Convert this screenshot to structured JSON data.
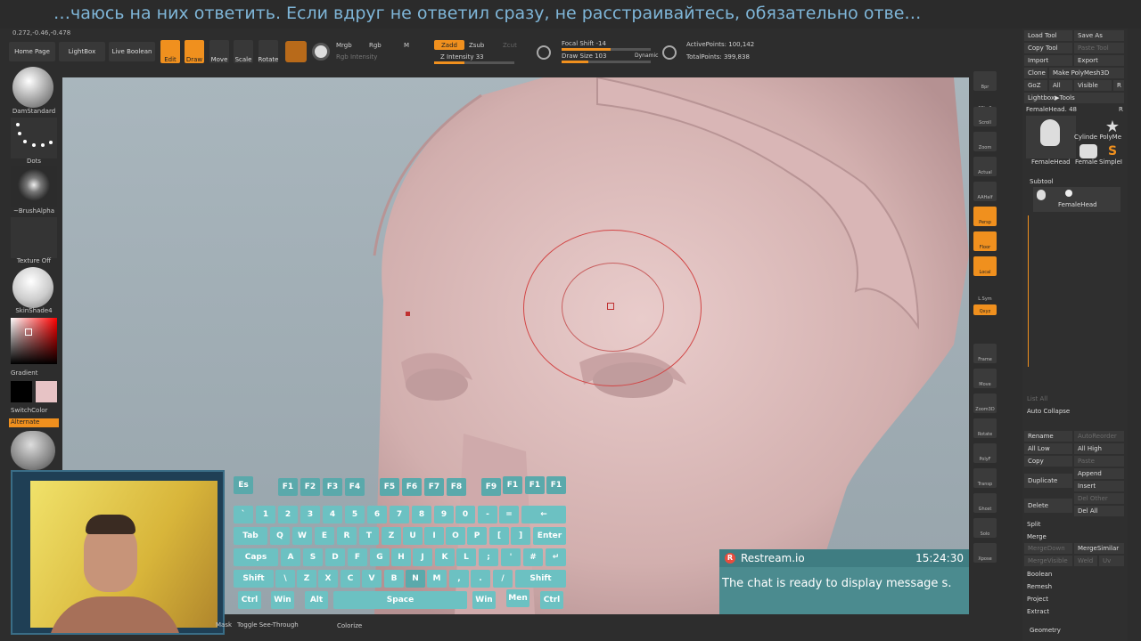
{
  "caption": {
    "text": "…чаюсь на них ответить. Если вдруг не ответил сразу, не расстраивайтесь, обязательно отве…"
  },
  "coords": "0.272,-0.46,-0.478",
  "topbar": {
    "home_page": "Home Page",
    "lightbox": "LightBox",
    "live_boolean": "Live Boolean",
    "edit": "Edit",
    "draw": "Draw",
    "move": "Move",
    "scale": "Scale",
    "rotate": "Rotate",
    "mrgb": "Mrgb",
    "rgb": "Rgb",
    "m": "M",
    "rgb_intensity": "Rgb Intensity",
    "zadd": "Zadd",
    "zsub": "Zsub",
    "zcut": "Zcut",
    "z_intensity": "Z Intensity 33",
    "focal_shift": "Focal Shift -14",
    "draw_size": "Draw Size 103",
    "dynamic": "Dynamic",
    "active_points": "ActivePoints: 100,142",
    "total_points": "TotalPoints: 399,838"
  },
  "left_panel": {
    "brush": "DamStandard",
    "stroke": "Dots",
    "alpha": "~BrushAlpha",
    "texture": "Texture Off",
    "material": "SkinShade4",
    "gradient": "Gradient",
    "switch_color": "SwitchColor",
    "alternate": "Alternate"
  },
  "right_strip": [
    "Bpr",
    "SPix 3",
    "Scroll",
    "Zoom",
    "Actual",
    "AAHalf",
    "Persp",
    "Floor",
    "Local",
    "L.Sym",
    "Qxyz",
    "",
    "Frame",
    "Move",
    "Zoom3D",
    "Rotate",
    "PolyF",
    "Transp",
    "Ghost",
    "Solo",
    "Xpose"
  ],
  "right_panel": {
    "load_tool": "Load Tool",
    "save_as": "Save As",
    "copy_tool": "Copy Tool",
    "paste_tool": "Paste Tool",
    "import": "Import",
    "export": "Export",
    "clone": "Clone",
    "make_polymesh": "Make PolyMesh3D",
    "goz": "GoZ",
    "all": "All",
    "visible": "Visible",
    "r": "R",
    "lightbox_tools": "Lightbox▶Tools",
    "female_head_48": "FemaleHead. 48",
    "tool_thumbs": [
      "FemaleHead",
      "Cylinde PolyMe",
      "Female",
      "SimpleI"
    ],
    "subtool": "Subtool",
    "subtool_item": "FemaleHead",
    "list_all": "List All",
    "auto_collapse": "Auto Collapse",
    "rename": "Rename",
    "auto_reorder": "AutoReorder",
    "all_low": "All Low",
    "all_high": "All High",
    "copy": "Copy",
    "paste": "Paste",
    "duplicate": "Duplicate",
    "append": "Append",
    "insert": "Insert",
    "delete": "Delete",
    "del_other": "Del Other",
    "del_all": "Del All",
    "split": "Split",
    "merge": "Merge",
    "merge_down": "MergeDown",
    "merge_similar": "MergeSimilar",
    "merge_visible": "MergeVisible",
    "weld": "Weld",
    "uv": "Uv",
    "boolean": "Boolean",
    "remesh": "Remesh",
    "project": "Project",
    "extract": "Extract",
    "geometry": "Geometry"
  },
  "keyboard": {
    "row0": [
      "Es",
      "F1",
      "F2",
      "F3",
      "F4",
      "F5",
      "F6",
      "F7",
      "F8",
      "F9",
      "F1",
      "F1",
      "F1"
    ],
    "row1": [
      "`",
      "1",
      "2",
      "3",
      "4",
      "5",
      "6",
      "7",
      "8",
      "9",
      "0",
      "-",
      "=",
      "←"
    ],
    "row2": [
      "Tab",
      "Q",
      "W",
      "E",
      "R",
      "T",
      "Z",
      "U",
      "I",
      "O",
      "P",
      "[",
      "]",
      "Enter"
    ],
    "row3": [
      "Caps",
      "A",
      "S",
      "D",
      "F",
      "G",
      "H",
      "J",
      "K",
      "L",
      ";",
      "'",
      "#",
      "↵"
    ],
    "row4": [
      "Shift",
      "\\",
      "Z",
      "X",
      "C",
      "V",
      "B",
      "N",
      "M",
      ",",
      ".",
      "/",
      "Shift"
    ],
    "row5": [
      "Ctrl",
      "Win",
      "Alt",
      "Space",
      "Win",
      "Men",
      "Ctrl"
    ]
  },
  "restream": {
    "title": "Restream.io",
    "time": "15:24:30",
    "message": "The chat is ready to display message s."
  },
  "bottom": {
    "mask": "Mask",
    "toggle": "Toggle See-Through",
    "colorize": "Colorize"
  }
}
